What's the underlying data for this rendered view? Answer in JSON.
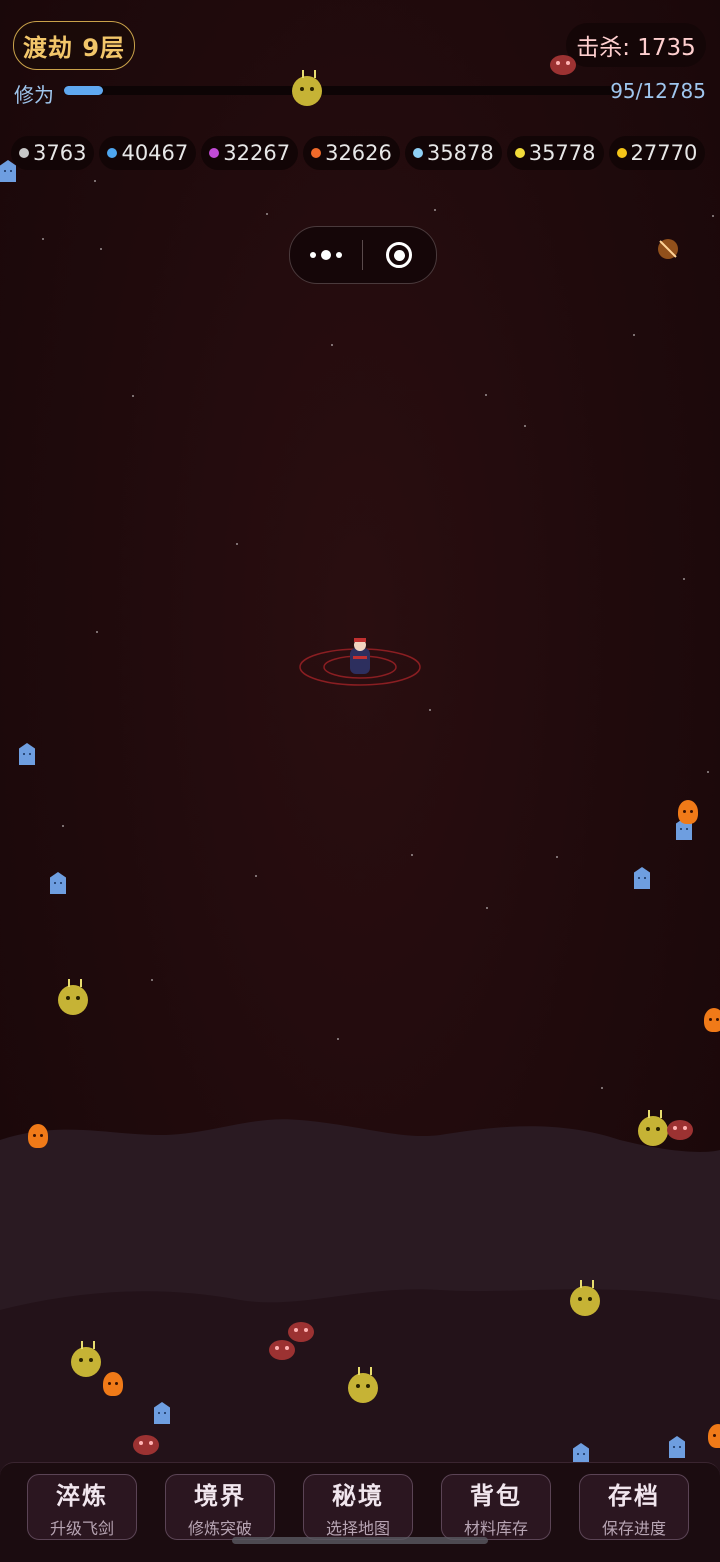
{
  "header": {
    "realm": "渡劫 9层",
    "kills_label": "击杀: 1735",
    "cultivation_label": "修为",
    "cultivation_progress": 0.07,
    "cultivation_text": "95/12785"
  },
  "materials": [
    {
      "color": "#c8c8c8",
      "value": "3763"
    },
    {
      "color": "#4ea6f0",
      "value": "40467"
    },
    {
      "color": "#c24bd6",
      "value": "32267"
    },
    {
      "color": "#f06a2a",
      "value": "32626"
    },
    {
      "color": "#8fd0f5",
      "value": "35878"
    },
    {
      "color": "#f2dc3a",
      "value": "35778"
    },
    {
      "color": "#f5c518",
      "value": "27770"
    }
  ],
  "colors": {
    "accent_gold": "#f2c66a",
    "xp_bar": "#5fa8f0",
    "background": "#1f0a0c"
  },
  "bottom_nav": [
    {
      "label": "淬炼",
      "sub": "升级飞剑"
    },
    {
      "label": "境界",
      "sub": "修炼突破"
    },
    {
      "label": "秘境",
      "sub": "选择地图"
    },
    {
      "label": "背包",
      "sub": "材料库存"
    },
    {
      "label": "存档",
      "sub": "保存进度"
    }
  ],
  "icons": {
    "capsule_more": "more-dots-icon",
    "capsule_close": "target-icon"
  }
}
